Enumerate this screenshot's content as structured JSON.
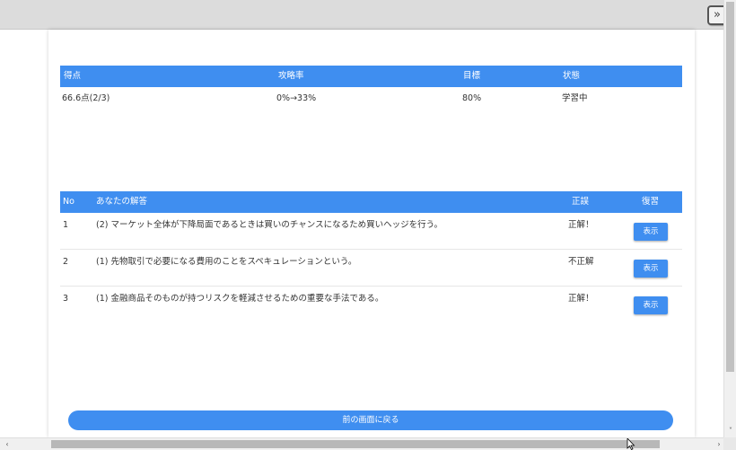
{
  "toolbar": {
    "collapse_icon": "double-chevron-right-icon",
    "collapse_glyph": "»"
  },
  "summary": {
    "headers": {
      "score": "得点",
      "capture_rate": "攻略率",
      "target": "目標",
      "status": "状態"
    },
    "row": {
      "score": "66.6点(2/3)",
      "capture_rate": "0%→33%",
      "target": "80%",
      "status": "学習中"
    }
  },
  "answers": {
    "headers": {
      "no": "No",
      "your_answer": "あなたの解答",
      "correctness": "正誤",
      "review": "復習"
    },
    "rows": [
      {
        "no": "1",
        "answer": "(2) マーケット全体が下降局面であるときは買いのチャンスになるため買いヘッジを行う。",
        "result": "正解！",
        "button": "表示"
      },
      {
        "no": "2",
        "answer": "(1) 先物取引で必要になる費用のことをスペキュレーションという。",
        "result": "不正解",
        "button": "表示"
      },
      {
        "no": "3",
        "answer": "(1) 金融商品そのものが持つリスクを軽減させるための重要な手法である。",
        "result": "正解！",
        "button": "表示"
      }
    ]
  },
  "back_button": {
    "label": "前の画面に戻る"
  },
  "colors": {
    "accent": "#3f8ef0",
    "topbar": "#dcdcdc"
  },
  "scrollbars": {
    "up_down_icon": "chevron-down-icon",
    "left_right_icon": "chevron-left-right-icon"
  }
}
